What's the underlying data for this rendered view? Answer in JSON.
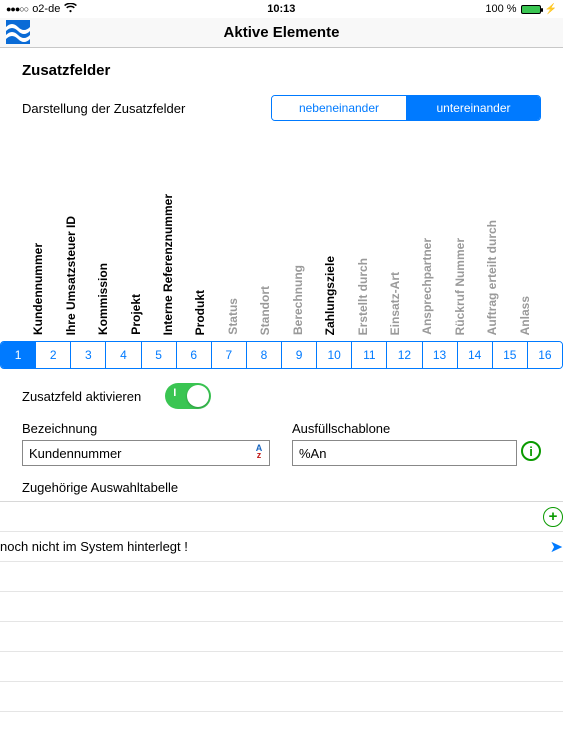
{
  "status": {
    "carrier": "o2-de",
    "time": "10:13",
    "battery_pct": "100 %"
  },
  "nav": {
    "title": "Aktive Elemente"
  },
  "section": {
    "title": "Zusatzfelder",
    "display_label": "Darstellung der Zusatzfelder",
    "seg": {
      "opt1": "nebeneinander",
      "opt2": "untereinander",
      "selected": 2
    }
  },
  "columns": [
    {
      "n": "1",
      "label": "Kundennummer",
      "active": true
    },
    {
      "n": "2",
      "label": "Ihre Umsatzsteuer ID",
      "active": true
    },
    {
      "n": "3",
      "label": "Kommission",
      "active": true
    },
    {
      "n": "4",
      "label": "Projekt",
      "active": true
    },
    {
      "n": "5",
      "label": "Interne Referenznummer",
      "active": true
    },
    {
      "n": "6",
      "label": "Produkt",
      "active": true
    },
    {
      "n": "7",
      "label": "Status",
      "active": false
    },
    {
      "n": "8",
      "label": "Standort",
      "active": false
    },
    {
      "n": "9",
      "label": "Berechnung",
      "active": false
    },
    {
      "n": "10",
      "label": "Zahlungsziele",
      "active": true
    },
    {
      "n": "11",
      "label": "Erstellt durch",
      "active": false
    },
    {
      "n": "12",
      "label": "Einsatz-Art",
      "active": false
    },
    {
      "n": "13",
      "label": "Ansprechpartner",
      "active": false
    },
    {
      "n": "14",
      "label": "Rückruf Nummer",
      "active": false
    },
    {
      "n": "15",
      "label": "Auftrag erteilt durch",
      "active": false
    },
    {
      "n": "16",
      "label": "Anlass",
      "active": false
    }
  ],
  "selected_column": 1,
  "activate": {
    "label": "Zusatzfeld aktivieren",
    "on": true
  },
  "fields": {
    "bezeichnung": {
      "label": "Bezeichnung",
      "value": "Kundennummer"
    },
    "schablone": {
      "label": "Ausfüllschablone",
      "value": "%An"
    }
  },
  "list": {
    "label": "Zugehörige Auswahltabelle",
    "rows": [
      {
        "text": "noch nicht im System hinterlegt !"
      }
    ]
  }
}
